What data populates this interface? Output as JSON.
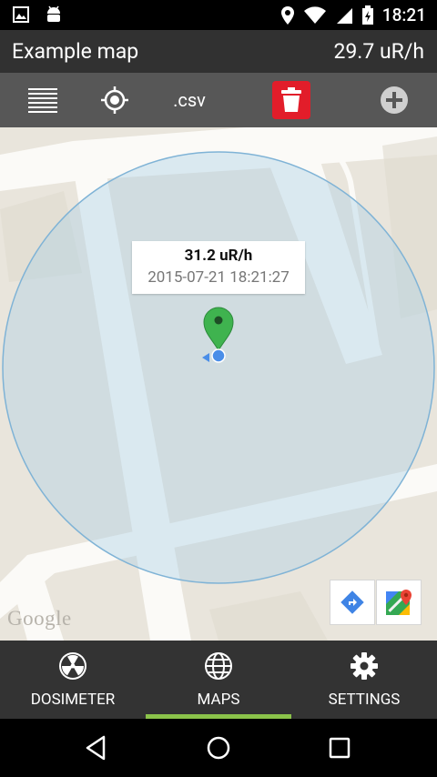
{
  "status_bar": {
    "time": "18:21",
    "left_icons": [
      "image-icon",
      "android-icon"
    ],
    "right_icons": [
      "location-icon",
      "wifi-icon",
      "cell-signal-icon",
      "battery-icon"
    ]
  },
  "header": {
    "title": "Example map",
    "reading": "29.7 uR/h"
  },
  "toolbar": {
    "items": [
      "list-icon",
      "crosshair-icon"
    ],
    "csv_label": ".csv",
    "delete_color": "#e21d2a"
  },
  "map": {
    "popup": {
      "value": "31.2 uR/h",
      "timestamp": "2015-07-21 18:21:27"
    },
    "marker_color": "#3fb34f",
    "accuracy_circle_color": "#aacfe6",
    "attribution": "Google"
  },
  "bottom_nav": {
    "tabs": [
      {
        "label": "DOSIMETER",
        "icon": "radiation-icon",
        "active": false
      },
      {
        "label": "MAPS",
        "icon": "globe-icon",
        "active": true
      },
      {
        "label": "SETTINGS",
        "icon": "gear-icon",
        "active": false
      }
    ],
    "active_color": "#8bc34a"
  },
  "system_nav": [
    "back-icon",
    "home-icon",
    "recents-icon"
  ]
}
